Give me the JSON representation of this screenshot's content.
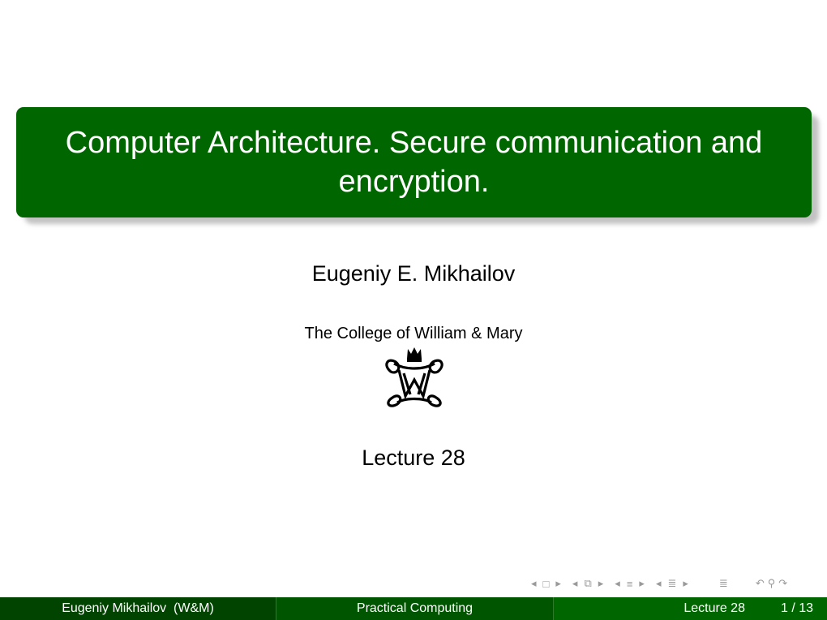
{
  "slide": {
    "title": "Computer Architecture. Secure communication and encryption.",
    "author": "Eugeniy E. Mikhailov",
    "institute": "The College of William & Mary",
    "logo": "william-and-mary-cypher-logo",
    "date": "Lecture 28"
  },
  "colors": {
    "title_bg": "#006600",
    "footer_left": "#004400",
    "footer_mid": "#005500",
    "footer_right": "#006600"
  },
  "navigation": {
    "icons": [
      "arrow-left",
      "frame",
      "arrow-right",
      "arrow-left",
      "subsection",
      "arrow-right",
      "arrow-left",
      "section",
      "arrow-right",
      "arrow-left",
      "subsection-list",
      "arrow-right",
      "outline",
      "back",
      "search",
      "forward"
    ]
  },
  "footer": {
    "author_short": "Eugeniy Mikhailov  (W&M)",
    "course": "Practical Computing",
    "lecture": "Lecture 28",
    "page": "1 / 13"
  }
}
